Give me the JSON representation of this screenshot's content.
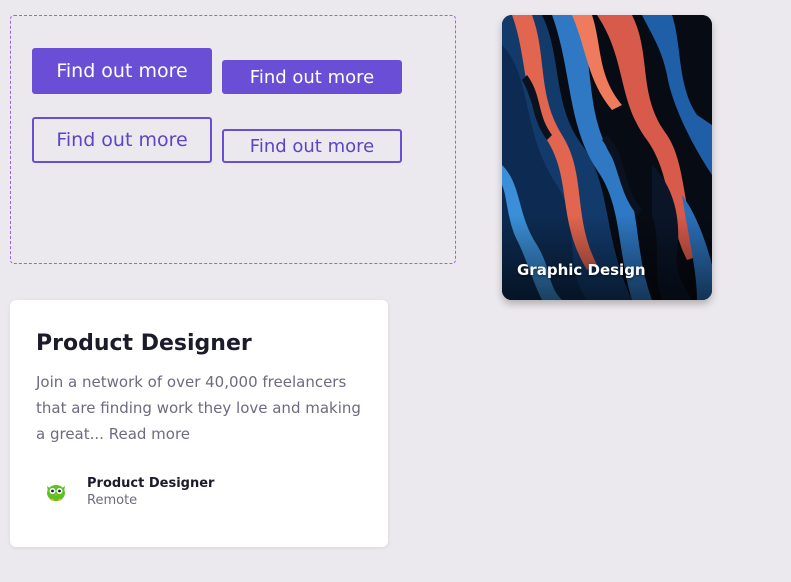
{
  "buttons": {
    "primary_large": "Find out more",
    "primary_small": "Find out more",
    "outline_large": "Find out more",
    "outline_small": "Find out more"
  },
  "art_card": {
    "title": "Graphic Design"
  },
  "job_card": {
    "title": "Product Designer",
    "description": "Join a network of over 40,000 freelancers that are finding work they love and making a great...",
    "read_more": "Read more",
    "company_name": "Product Designer",
    "company_location": "Remote",
    "logo_icon": "green-owl-icon"
  },
  "colors": {
    "accent": "#6a4fd6",
    "background": "#ece9ee",
    "frame_border": "#9b63e6"
  }
}
